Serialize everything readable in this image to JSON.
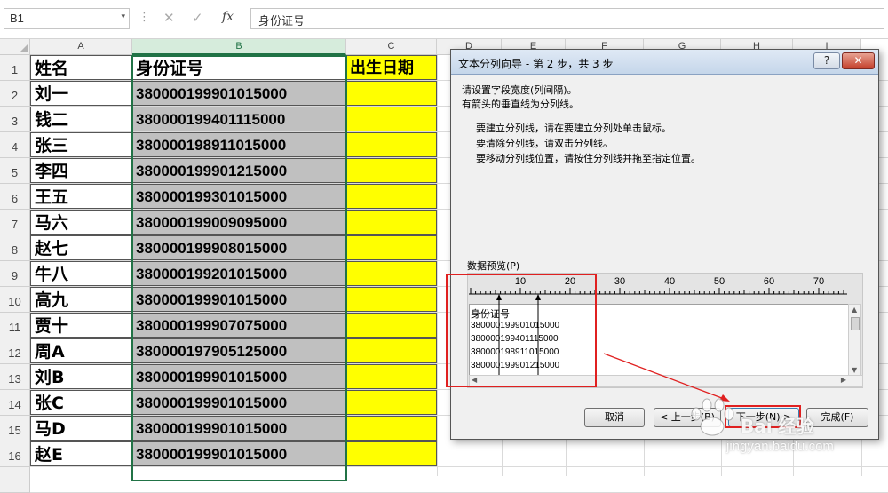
{
  "formula_bar": {
    "name_box": "B1",
    "name_box_dropdown": "▾",
    "dots": "⋮",
    "cancel": "✕",
    "enter": "✓",
    "fx": "fx",
    "content": "身份证号"
  },
  "columns": [
    {
      "label": "A",
      "selected": false
    },
    {
      "label": "B",
      "selected": true
    },
    {
      "label": "C",
      "selected": false
    },
    {
      "label": "D",
      "selected": false
    },
    {
      "label": "E",
      "selected": false
    },
    {
      "label": "F",
      "selected": false
    },
    {
      "label": "G",
      "selected": false
    },
    {
      "label": "H",
      "selected": false
    },
    {
      "label": "I",
      "selected": false
    }
  ],
  "rows": [
    "1",
    "2",
    "3",
    "4",
    "5",
    "6",
    "7",
    "8",
    "9",
    "10",
    "11",
    "12",
    "13",
    "14",
    "15",
    "16"
  ],
  "table": {
    "headers": [
      "姓名",
      "身份证号",
      "出生日期"
    ],
    "records": [
      [
        "刘一",
        "380000199901015000"
      ],
      [
        "钱二",
        "380000199401115000"
      ],
      [
        "张三",
        "380000198911015000"
      ],
      [
        "李四",
        "380000199901215000"
      ],
      [
        "王五",
        "380000199301015000"
      ],
      [
        "马六",
        "380000199009095000"
      ],
      [
        "赵七",
        "380000199908015000"
      ],
      [
        "牛八",
        "380000199201015000"
      ],
      [
        "高九",
        "380000199901015000"
      ],
      [
        "贾十",
        "380000199907075000"
      ],
      [
        "周A",
        "380000197905125000"
      ],
      [
        "刘B",
        "380000199901015000"
      ],
      [
        "张C",
        "380000199901015000"
      ],
      [
        "马D",
        "380000199901015000"
      ],
      [
        "赵E",
        "380000199901015000"
      ]
    ]
  },
  "dialog": {
    "title": "文本分列向导 - 第 2 步，共 3 步",
    "help": "?",
    "close": "✕",
    "instructions": [
      "请设置字段宽度(列间隔)。",
      "有箭头的垂直线为分列线。"
    ],
    "tips": [
      "要建立分列线，请在要建立分列处单击鼠标。",
      "要清除分列线，请双击分列线。",
      "要移动分列线位置，请按住分列线并拖至指定位置。"
    ],
    "preview_label": "数据预览(P)",
    "ruler_marks": [
      "10",
      "20",
      "30",
      "40",
      "50",
      "60",
      "70"
    ],
    "preview_lines": [
      "身份证号",
      "380000199901015000",
      "380000199401115000",
      "380000198911015000",
      "380000199901215000"
    ],
    "buttons": {
      "cancel": "取消",
      "back": "< 上一步(B)",
      "next": "下一步(N) >",
      "finish": "完成(F)"
    }
  },
  "watermark": {
    "brand": "Bai 经验",
    "url": "jingyan.baidu.com"
  },
  "colors": {
    "accent": "#217346",
    "highlight": "#e02020",
    "yellow": "#ffff00",
    "gray_fill": "#c0c0c0"
  }
}
